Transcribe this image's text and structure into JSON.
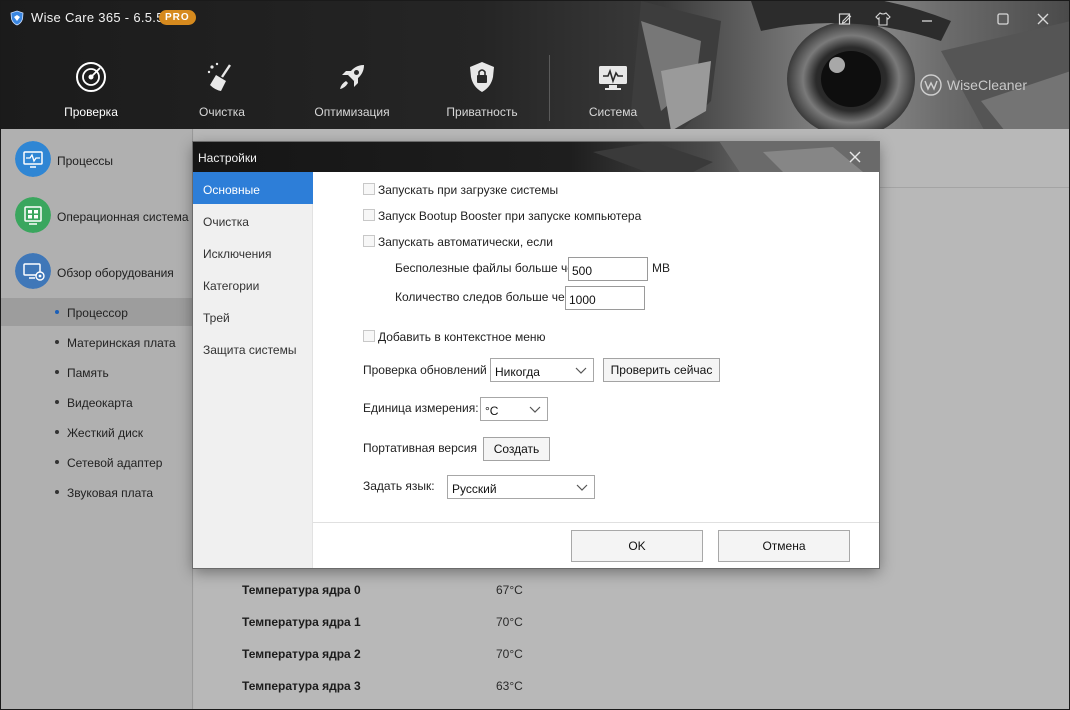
{
  "window": {
    "title": "Wise Care 365 - 6.5.5",
    "badge": "PRO",
    "brand": "WiseCleaner"
  },
  "nav": [
    {
      "label": "Проверка",
      "icon": "radar-icon"
    },
    {
      "label": "Очистка",
      "icon": "broom-icon"
    },
    {
      "label": "Оптимизация",
      "icon": "rocket-icon"
    },
    {
      "label": "Приватность",
      "icon": "shield-lock-icon"
    },
    {
      "label": "Система",
      "icon": "monitor-pulse-icon"
    }
  ],
  "sidebar": {
    "categories": [
      {
        "label": "Процессы",
        "icon": "monitor-pulse-icon",
        "color": "#2f86d4"
      },
      {
        "label": "Операционная система",
        "icon": "windows-icon",
        "color": "#3aa65e"
      },
      {
        "label": "Обзор оборудования",
        "icon": "hardware-icon",
        "color": "#3f77b8"
      }
    ],
    "items": [
      {
        "label": "Процессор",
        "active": true
      },
      {
        "label": "Материнская плата"
      },
      {
        "label": "Память"
      },
      {
        "label": "Видеокарта"
      },
      {
        "label": "Жесткий диск"
      },
      {
        "label": "Сетевой адаптер"
      },
      {
        "label": "Звуковая плата"
      }
    ]
  },
  "specs": [
    {
      "key": "Температура ядра 0",
      "value": "67°C"
    },
    {
      "key": "Температура ядра 1",
      "value": "70°C"
    },
    {
      "key": "Температура ядра 2",
      "value": "70°C"
    },
    {
      "key": "Температура ядра 3",
      "value": "63°C"
    }
  ],
  "dialog": {
    "title": "Настройки",
    "menu": [
      {
        "label": "Основные",
        "active": true
      },
      {
        "label": "Очистка"
      },
      {
        "label": "Исключения"
      },
      {
        "label": "Категории"
      },
      {
        "label": "Трей"
      },
      {
        "label": "Защита системы"
      }
    ],
    "options": {
      "startup": "Запускать при загрузке системы",
      "bootup_booster": "Запуск Bootup Booster при запуске компьютера",
      "auto_run": "Запускать автоматически, если",
      "junk_label": "Бесполезные файлы больше чем",
      "junk_value": "500",
      "junk_unit": "MB",
      "traces_label": "Количество следов больше чем",
      "traces_value": "1000",
      "context_menu": "Добавить в контекстное меню",
      "updates_label": "Проверка обновлений",
      "updates_value": "Никогда",
      "check_now": "Проверить сейчас",
      "unit_label": "Единица измерения:",
      "unit_value": "°C",
      "portable_label": "Портативная версия",
      "create": "Создать",
      "language_label": "Задать язык:",
      "language_value": "Русский"
    },
    "ok": "OK",
    "cancel": "Отмена"
  }
}
